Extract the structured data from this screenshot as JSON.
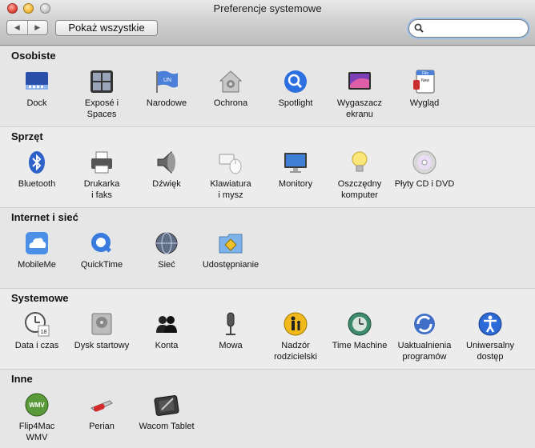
{
  "window": {
    "title": "Preferencje systemowe"
  },
  "toolbar": {
    "back": "◀",
    "forward": "▶",
    "show_all": "Pokaż wszystkie",
    "search_value": ""
  },
  "sections": [
    {
      "title": "Osobiste",
      "items": [
        "Dock",
        "Exposé i\nSpaces",
        "Narodowe",
        "Ochrona",
        "Spotlight",
        "Wygaszacz\nekranu",
        "Wygląd"
      ]
    },
    {
      "title": "Sprzęt",
      "items": [
        "Bluetooth",
        "Drukarka\ni faks",
        "Dźwięk",
        "Klawiatura\ni mysz",
        "Monitory",
        "Oszczędny\nkomputer",
        "Płyty CD i DVD"
      ]
    },
    {
      "title": "Internet i sieć",
      "items": [
        "MobileMe",
        "QuickTime",
        "Sieć",
        "Udostępnianie"
      ]
    },
    {
      "title": "Systemowe",
      "items": [
        "Data i czas",
        "Dysk startowy",
        "Konta",
        "Mowa",
        "Nadzór\nrodzicielski",
        "Time Machine",
        "Uaktualnienia\nprogramów",
        "Uniwersalny\ndostęp"
      ]
    },
    {
      "title": "Inne",
      "items": [
        "Flip4Mac\nWMV",
        "Perian",
        "Wacom Tablet"
      ]
    }
  ],
  "icons": {
    "flag_text": "UN",
    "file_text": "File",
    "new_text": "New",
    "calendar_day": "18",
    "wmv_text": "WMV"
  }
}
